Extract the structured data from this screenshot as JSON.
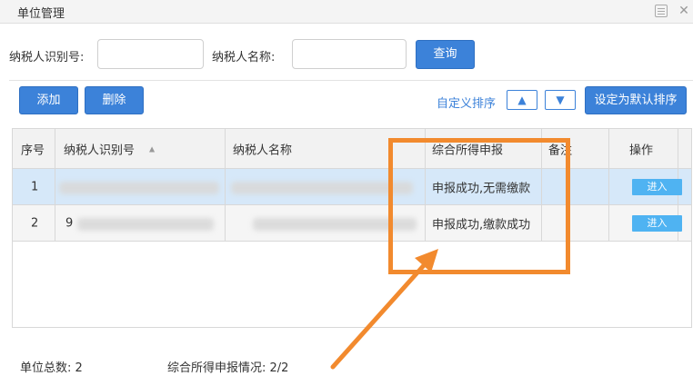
{
  "window": {
    "title": "单位管理"
  },
  "search": {
    "id_label": "纳税人识别号:",
    "id_value": "",
    "name_label": "纳税人名称:",
    "name_value": "",
    "query_label": "查询"
  },
  "toolbar": {
    "add_label": "添加",
    "delete_label": "删除",
    "custom_sort_label": "自定义排序",
    "up_arrow": "▲",
    "down_arrow": "▼",
    "set_default_label": "设定为默认排序"
  },
  "table": {
    "headers": {
      "seq": "序号",
      "tax_id": "纳税人识别号",
      "sort_indicator": "▲",
      "tax_name": "纳税人名称",
      "status": "综合所得申报",
      "remark": "备注",
      "action": "操作"
    },
    "rows": [
      {
        "seq": "1",
        "status": "申报成功,无需缴款",
        "remark": "",
        "action": "进入"
      },
      {
        "seq": "2",
        "tax_id_partial": "9",
        "status": "申报成功,缴款成功",
        "remark": "",
        "action": "进入"
      }
    ]
  },
  "footer": {
    "unit_count": "单位总数:  2",
    "declare_status": "综合所得申报情况:  2/2"
  },
  "colors": {
    "accent": "#3c82d9",
    "annotation": "#f28a2e",
    "selected_row": "#d6e8f9",
    "enter_button": "#4fb3f2"
  },
  "icons": {
    "restore": "restore-icon",
    "close": "close-icon"
  }
}
